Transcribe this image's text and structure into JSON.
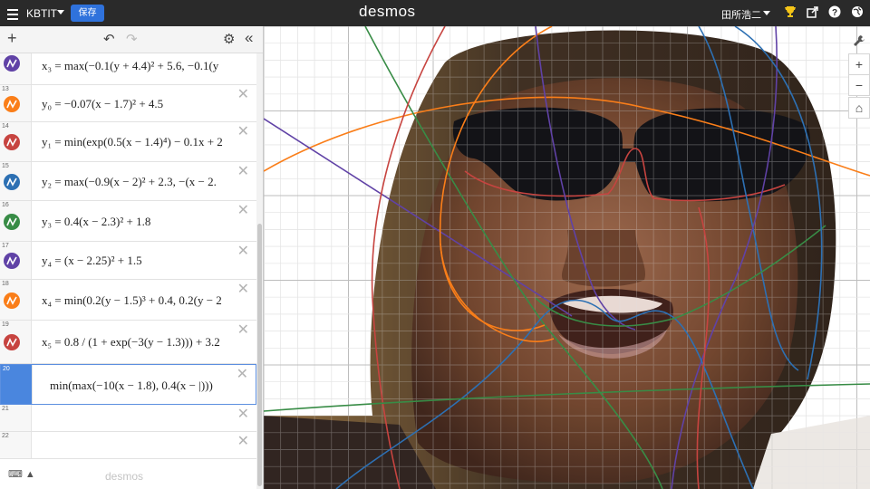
{
  "topbar": {
    "title": "KBTIT",
    "save_label": "保存",
    "brand": "desmos",
    "user_name": "田所浩二",
    "icons": [
      "menu-icon",
      "trophy-icon",
      "share-icon",
      "help-icon",
      "globe-icon"
    ]
  },
  "toolbar": {
    "add_icon": "+",
    "undo_icon": "↶",
    "redo_icon": "↷",
    "settings_icon": "⚙",
    "collapse_icon": "«"
  },
  "expressions": [
    {
      "num": "",
      "color": "#6042a6",
      "latex": "x₃ = max(−0.1(y + 4.4)² + 5.6, −0.1(y"
    },
    {
      "num": "13",
      "color": "#fa7e19",
      "latex": "y₀ = −0.07(x − 1.7)² + 4.5"
    },
    {
      "num": "14",
      "color": "#c74440",
      "latex": "y₁ = min(exp(0.5(x − 1.4)⁴) − 0.1x + 2"
    },
    {
      "num": "15",
      "color": "#2d70b3",
      "latex": "y₂ = max(−0.9(x − 2)² + 2.3, −(x − 2."
    },
    {
      "num": "16",
      "color": "#388c46",
      "latex": "y₃ = 0.4(x − 2.3)² + 1.8"
    },
    {
      "num": "17",
      "color": "#6042a6",
      "latex": "y₄ = (x − 2.25)² + 1.5"
    },
    {
      "num": "18",
      "color": "#fa7e19",
      "latex": "x₄ = min(0.2(y − 1.5)³ + 0.4, 0.2(y − 2"
    },
    {
      "num": "19",
      "color": "#c74440",
      "latex": "x₅ = 0.8 / (1 + exp(−3(y − 1.3))) + 3.2"
    },
    {
      "num": "20",
      "color": "",
      "latex": "min(max(−10(x − 1.8), 0.4(x − |)))"
    },
    {
      "num": "21",
      "color": "",
      "latex": ""
    },
    {
      "num": "22",
      "color": "",
      "latex": ""
    }
  ],
  "footer": {
    "keyboard_icon": "⌨ ▲",
    "watermark": "desmos"
  },
  "graph_controls": {
    "wrench_icon": "🔧",
    "zoom_in": "+",
    "zoom_out": "−",
    "home_icon": "⌂"
  },
  "colors": {
    "red": "#c74440",
    "blue": "#2d70b3",
    "green": "#388c46",
    "purple": "#6042a6",
    "orange": "#fa7e19",
    "active_blue": "#4a86de"
  }
}
